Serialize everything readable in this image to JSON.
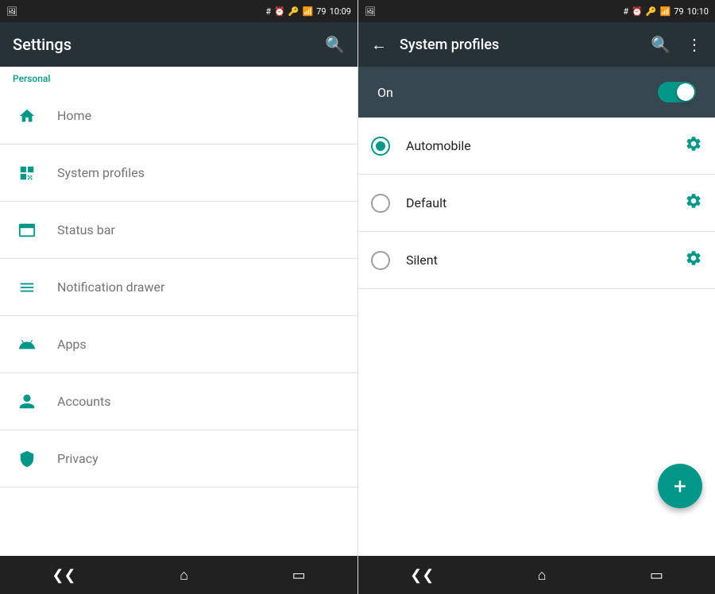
{
  "left": {
    "status_bar": {
      "time": "10:09",
      "icons": [
        "#",
        "⏰",
        "🔑",
        "📶",
        "🔋"
      ]
    },
    "toolbar": {
      "title": "Settings",
      "search_label": "search"
    },
    "section_label": "Personal",
    "menu_items": [
      {
        "id": "home",
        "icon": "home",
        "label": "Home"
      },
      {
        "id": "system-profiles",
        "icon": "profile",
        "label": "System profiles"
      },
      {
        "id": "status-bar",
        "icon": "statusbar",
        "label": "Status bar"
      },
      {
        "id": "notification-drawer",
        "icon": "notif",
        "label": "Notification drawer"
      },
      {
        "id": "apps",
        "icon": "apps",
        "label": "Apps"
      },
      {
        "id": "accounts",
        "icon": "accounts",
        "label": "Accounts"
      },
      {
        "id": "privacy",
        "icon": "privacy",
        "label": "Privacy"
      }
    ],
    "nav": {
      "back_label": "back",
      "home_label": "home",
      "recents_label": "recents"
    }
  },
  "right": {
    "status_bar": {
      "time": "10:10",
      "icons": [
        "#",
        "⏰",
        "🔑",
        "📶",
        "🔋"
      ]
    },
    "toolbar": {
      "back_label": "back",
      "title": "System profiles",
      "search_label": "search",
      "more_label": "more options"
    },
    "toggle": {
      "label": "On",
      "enabled": true
    },
    "profiles": [
      {
        "id": "automobile",
        "label": "Automobile",
        "selected": true
      },
      {
        "id": "default",
        "label": "Default",
        "selected": false
      },
      {
        "id": "silent",
        "label": "Silent",
        "selected": false
      }
    ],
    "fab_label": "+",
    "nav": {
      "back_label": "back",
      "home_label": "home",
      "recents_label": "recents"
    }
  }
}
